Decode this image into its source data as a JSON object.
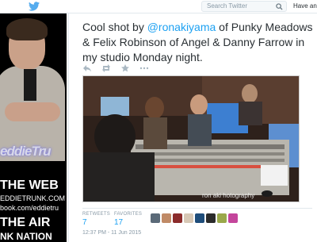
{
  "header": {
    "search_placeholder": "Search Twitter",
    "account_prompt": "Have an a"
  },
  "background": {
    "logo_text": "eddieTru",
    "line_web": "THE WEB",
    "url_line1": "EDDIETRUNK.COM",
    "url_line2": "book.com/eddietru",
    "line_air": "THE AIR",
    "line_nation": "NK NATION"
  },
  "tweet": {
    "text_before": "Cool shot by ",
    "mention": "@ronakiyama",
    "text_after": " of Punky Meadows & Felix Robinson of Angel & Danny Farrow in my studio Monday night.",
    "photo_watermark": "ron aki      hotography",
    "retweets_label": "RETWEETS",
    "retweets_count": "7",
    "favorites_label": "FAVORITES",
    "favorites_count": "17",
    "timestamp": "12:37 PM - 11 Jun 2015"
  },
  "colors": {
    "accent": "#1da1f2",
    "text": "#292f33",
    "muted": "#8899a6"
  },
  "icons": [
    "twitter-bird-icon",
    "search-icon",
    "reply-icon",
    "retweet-icon",
    "favorite-icon",
    "more-icon"
  ]
}
